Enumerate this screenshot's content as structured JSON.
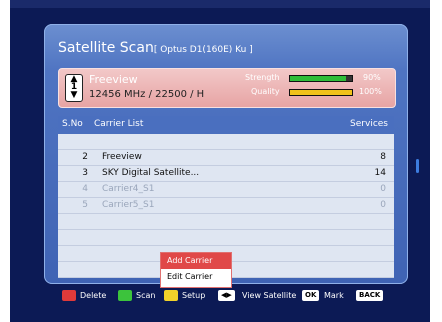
{
  "screen": {
    "title": "Satellite Scan",
    "subtitle": "[ Optus D1(160E) Ku ]"
  },
  "current": {
    "name": "Freeview",
    "freq": "12456 MHz / 22500 / H",
    "strength_label": "Strength",
    "strength_pct": "90%",
    "strength_value": 0.9,
    "quality_label": "Quality",
    "quality_pct": "100%",
    "quality_value": 1.0
  },
  "table": {
    "col_no": "S.No",
    "col_list": "Carrier List",
    "col_services": "Services",
    "rows": [
      {
        "no": "",
        "name": "",
        "services": "",
        "muted": false
      },
      {
        "no": "2",
        "name": "Freeview",
        "services": "8",
        "muted": false
      },
      {
        "no": "3",
        "name": "SKY Digital Satellite...",
        "services": "14",
        "muted": false
      },
      {
        "no": "4",
        "name": "Carrier4_S1",
        "services": "0",
        "muted": true
      },
      {
        "no": "5",
        "name": "Carrier5_S1",
        "services": "0",
        "muted": true
      },
      {
        "no": "",
        "name": "",
        "services": "",
        "muted": false
      },
      {
        "no": "",
        "name": "",
        "services": "",
        "muted": false
      },
      {
        "no": "",
        "name": "",
        "services": "",
        "muted": false
      },
      {
        "no": "",
        "name": "",
        "services": "",
        "muted": false
      }
    ]
  },
  "popup": {
    "items": [
      "Add Carrier",
      "Edit Carrier"
    ]
  },
  "footer": {
    "delete": "Delete",
    "scan": "Scan",
    "setup": "Setup",
    "view": "View Satellite",
    "mark_key": "OK",
    "mark": "Mark",
    "back_key": "BACK"
  },
  "colors": {
    "red": "#e03a3a",
    "green": "#3cc33c",
    "yellow": "#f2d22a",
    "bar_strength": "#2fbd3a",
    "bar_quality": "#f0c21a"
  }
}
